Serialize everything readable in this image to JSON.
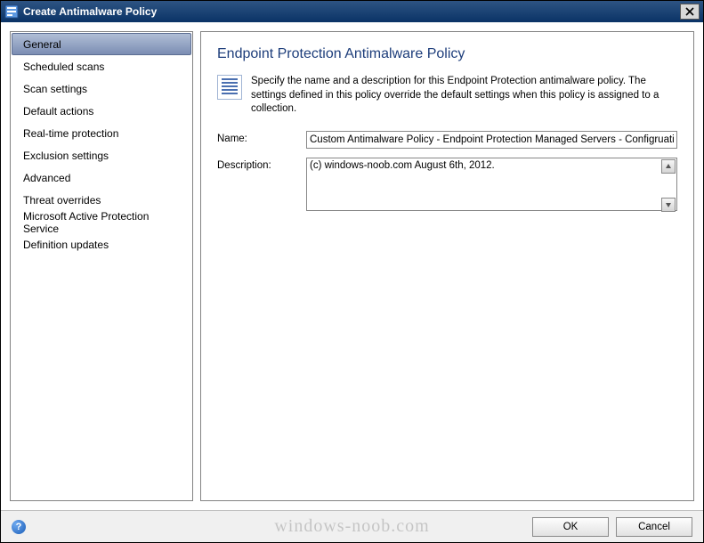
{
  "titlebar": {
    "title": "Create Antimalware Policy"
  },
  "sidebar": {
    "items": [
      {
        "label": "General",
        "selected": true
      },
      {
        "label": "Scheduled scans",
        "selected": false
      },
      {
        "label": "Scan settings",
        "selected": false
      },
      {
        "label": "Default actions",
        "selected": false
      },
      {
        "label": "Real-time protection",
        "selected": false
      },
      {
        "label": "Exclusion settings",
        "selected": false
      },
      {
        "label": "Advanced",
        "selected": false
      },
      {
        "label": "Threat overrides",
        "selected": false
      },
      {
        "label": "Microsoft Active Protection Service",
        "selected": false
      },
      {
        "label": "Definition updates",
        "selected": false
      }
    ]
  },
  "panel": {
    "heading": "Endpoint Protection Antimalware Policy",
    "description": "Specify the name and a description for this Endpoint Protection antimalware policy. The settings defined in this policy override the default settings when this policy is assigned to a collection.",
    "name_label": "Name:",
    "name_value": "Custom Antimalware Policy - Endpoint Protection Managed Servers - Configruation Ma",
    "desc_label": "Description:",
    "desc_value": "(c) windows-noob.com August 6th, 2012."
  },
  "footer": {
    "help_symbol": "?",
    "ok_label": "OK",
    "cancel_label": "Cancel"
  },
  "watermark": "windows-noob.com"
}
